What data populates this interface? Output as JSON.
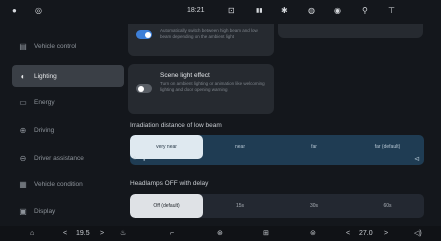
{
  "status_bar": {
    "time": "18:21",
    "icons": [
      "profile-icon",
      "location-icon",
      "lock-icon",
      "signal-icon",
      "bluetooth-icon",
      "mute-icon",
      "camera-icon",
      "person-icon",
      "pin-icon"
    ]
  },
  "sidebar": {
    "items": [
      {
        "label": "Vehicle control",
        "icon": "car-icon"
      },
      {
        "label": "Lighting",
        "icon": "light-icon"
      },
      {
        "label": "Energy",
        "icon": "energy-icon"
      },
      {
        "label": "Driving",
        "icon": "driving-icon"
      },
      {
        "label": "Driver assistance",
        "icon": "assist-icon"
      },
      {
        "label": "Vehicle condition",
        "icon": "condition-icon"
      },
      {
        "label": "Display",
        "icon": "display-icon"
      }
    ],
    "active_index": 1
  },
  "main": {
    "auto_beam_desc": "Automatically switch between high beam and low beam depending on the ambient light",
    "scene_light": {
      "title": "Scene light effect",
      "desc": "Turn on ambient lighting or animation like welcoming lighting and door opening warning"
    },
    "irradiation": {
      "label": "Irradiation distance of low beam",
      "options": [
        "very near",
        "near",
        "far",
        "far (default)"
      ],
      "selected_index": 0
    },
    "headlamps_off": {
      "label": "Headlamps OFF with delay",
      "options": [
        "Off (default)",
        "15s",
        "30s",
        "60s"
      ],
      "selected_index": 0
    }
  },
  "bottom_bar": {
    "left_temp": "19.5",
    "right_temp": "27.0"
  },
  "colors": {
    "toggle_on": "#3d7fd8",
    "toggle_off": "#5a5f66",
    "blue_segment": "#1f3c53"
  }
}
